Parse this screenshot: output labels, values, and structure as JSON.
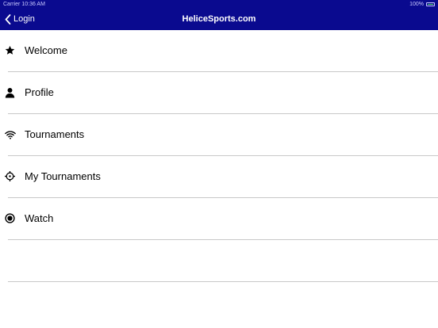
{
  "status_bar": {
    "carrier": "Carrier",
    "time": "10:36 AM",
    "battery": "100%",
    "battery_level": 1.0,
    "battery_color": "#4cd964"
  },
  "nav": {
    "back_label": "Login",
    "back_icon": "chevron-left-icon",
    "title": "HeliceSports.com",
    "bar_color": "#0a0a8f"
  },
  "menu": {
    "items": [
      {
        "label": "Welcome",
        "icon": "star-icon"
      },
      {
        "label": "Profile",
        "icon": "person-icon"
      },
      {
        "label": "Tournaments",
        "icon": "wifi-icon"
      },
      {
        "label": "My Tournaments",
        "icon": "crosshair-icon"
      },
      {
        "label": "Watch",
        "icon": "record-icon"
      },
      {
        "label": "",
        "icon": ""
      }
    ]
  }
}
